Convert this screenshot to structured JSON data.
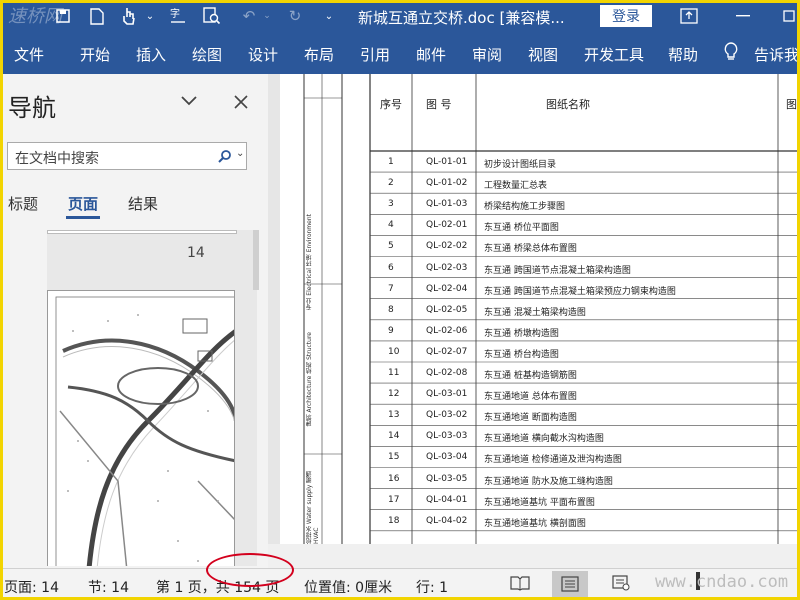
{
  "window": {
    "title": "新城互通立交桥.doc [兼容模...",
    "login_label": "登录",
    "brand": "速桥网"
  },
  "ribbon": {
    "tabs": [
      "文件",
      "开始",
      "插入",
      "绘图",
      "设计",
      "布局",
      "引用",
      "邮件",
      "审阅",
      "视图",
      "开发工具",
      "帮助",
      "告诉我"
    ]
  },
  "nav": {
    "title": "导航",
    "search_placeholder": "在文档中搜索",
    "tabs": [
      "标题",
      "页面",
      "结果"
    ],
    "active_tab": "页面",
    "page_number": "14"
  },
  "table": {
    "headers": {
      "seq": "序号",
      "drawing_no": "图 号",
      "drawing_name": "图纸名称",
      "extra": "图"
    },
    "rows": [
      {
        "n": "1",
        "code": "QL-01-01",
        "name": "初步设计图纸目录"
      },
      {
        "n": "2",
        "code": "QL-01-02",
        "name": "工程数量汇总表"
      },
      {
        "n": "3",
        "code": "QL-01-03",
        "name": "桥梁结构施工步骤图"
      },
      {
        "n": "4",
        "code": "QL-02-01",
        "name": "东互通 桥位平面图"
      },
      {
        "n": "5",
        "code": "QL-02-02",
        "name": "东互通 桥梁总体布置图"
      },
      {
        "n": "6",
        "code": "QL-02-03",
        "name": "东互通 跨国道节点混凝土箱梁构造图"
      },
      {
        "n": "7",
        "code": "QL-02-04",
        "name": "东互通 跨国道节点混凝土箱梁预应力钢束构造图"
      },
      {
        "n": "8",
        "code": "QL-02-05",
        "name": "东互通 混凝土箱梁构造图"
      },
      {
        "n": "9",
        "code": "QL-02-06",
        "name": "东互通 桥墩构造图"
      },
      {
        "n": "10",
        "code": "QL-02-07",
        "name": "东互通 桥台构造图"
      },
      {
        "n": "11",
        "code": "QL-02-08",
        "name": "东互通 桩基构造钢筋图"
      },
      {
        "n": "12",
        "code": "QL-03-01",
        "name": "东互通地道 总体布置图"
      },
      {
        "n": "13",
        "code": "QL-03-02",
        "name": "东互通地道 断面构造图"
      },
      {
        "n": "14",
        "code": "QL-03-03",
        "name": "东互通地道 横向截水沟构造图"
      },
      {
        "n": "15",
        "code": "QL-03-04",
        "name": "东互通地道 检修通道及泄沟构造图"
      },
      {
        "n": "16",
        "code": "QL-03-05",
        "name": "东互通地道 防水及施工缝构造图"
      },
      {
        "n": "17",
        "code": "QL-04-01",
        "name": "东互通地道基坑 平面布置图"
      },
      {
        "n": "18",
        "code": "QL-04-02",
        "name": "东互通地道基坑 横剖面图"
      }
    ],
    "side_labels": [
      "专业 Electrical 环境 Environment",
      "建筑 Architecture 结构 Structure",
      "给排水 Water supply 暖通 HVAC"
    ]
  },
  "status": {
    "page": "页面: 14",
    "section": "节: 14",
    "page_of": "第 1 页，共 154 页",
    "position": "位置值: 0厘米",
    "line": "行: 1"
  },
  "watermark": "www.cndao.com",
  "colors": {
    "ribbon": "#2b579a",
    "highlight": "#d3001d",
    "frame": "#f2d400"
  }
}
